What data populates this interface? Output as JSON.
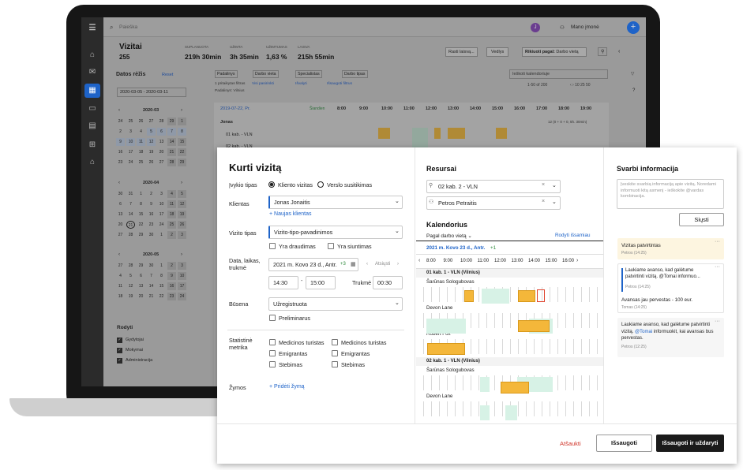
{
  "app": {
    "search_placeholder": "Paieška",
    "avatar_initial": "J",
    "company": "Mano įmonė",
    "add": "+"
  },
  "page": {
    "title": "Vizitai",
    "count": "255",
    "stats": [
      {
        "label": "SUPLANUOTA",
        "value": "219h 30min"
      },
      {
        "label": "UŽIMTA",
        "value": "3h 35min"
      },
      {
        "label": "UŽIMTUMAS",
        "value": "1,63 %"
      },
      {
        "label": "LAISVA",
        "value": "215h 55min"
      }
    ],
    "actions": {
      "find": "Rasti laisvą...",
      "guides": "Vedlys",
      "sort_label": "Rikiuoti pagal:",
      "sort_value": "Darbo vietą"
    }
  },
  "left": {
    "date_title": "Datos rėžis",
    "reset": "Reset",
    "date_range": "2020-03-05 - 2020-03-11",
    "months": [
      "2020-03",
      "2020-04",
      "2020-05"
    ],
    "march": [
      [
        "24",
        "25",
        "26",
        "27",
        "28",
        "29",
        "1"
      ],
      [
        "2",
        "3",
        "4",
        "5",
        "6",
        "7",
        "8"
      ],
      [
        "9",
        "10",
        "11",
        "12",
        "13",
        "14",
        "15"
      ],
      [
        "16",
        "17",
        "18",
        "19",
        "20",
        "21",
        "22"
      ],
      [
        "23",
        "24",
        "25",
        "26",
        "27",
        "28",
        "29"
      ]
    ],
    "april": [
      [
        "30",
        "31",
        "1",
        "2",
        "3",
        "4",
        "5"
      ],
      [
        "6",
        "7",
        "8",
        "9",
        "10",
        "11",
        "12"
      ],
      [
        "13",
        "14",
        "15",
        "16",
        "17",
        "18",
        "19"
      ],
      [
        "20",
        "21",
        "22",
        "23",
        "24",
        "25",
        "26"
      ],
      [
        "27",
        "28",
        "29",
        "30",
        "1",
        "2",
        "3"
      ]
    ],
    "may": [
      [
        "27",
        "28",
        "29",
        "30",
        "1",
        "2",
        "3"
      ],
      [
        "4",
        "5",
        "6",
        "7",
        "8",
        "9",
        "10"
      ],
      [
        "11",
        "12",
        "13",
        "14",
        "15",
        "16",
        "17"
      ],
      [
        "18",
        "19",
        "20",
        "21",
        "22",
        "23",
        "24"
      ]
    ],
    "show_title": "Rodyti",
    "show_items": [
      "Gydytojai",
      "Mokymai",
      "Administracija"
    ]
  },
  "filters": {
    "chips": [
      "Padalinys",
      "Darbo vieta",
      "Specialistas",
      "Darbo tipas"
    ],
    "applied": "1 pritaikytas filtras",
    "view_saved": "Visi pasirinkti",
    "clear_filters": "Išvalyti",
    "save_filters": "Išsaugoti filtrus",
    "tag": "Padalinys: Vilnius",
    "calendar_search": "Ieškoti kalendoriuje",
    "paging": "1-50 of 200",
    "page_nums": [
      "10",
      "25",
      "50"
    ]
  },
  "bg_cal": {
    "date": "2019-07-22, Pr.",
    "today": "Šiandien",
    "hours": [
      "8:00",
      "9:00",
      "10:00",
      "11:00",
      "12:00",
      "13:00",
      "14:00",
      "15:00",
      "16:00",
      "17:00",
      "18:00",
      "19:00"
    ],
    "person": "Jonas",
    "summary": "12 (0 + 0 + 0, 5h. 30min)",
    "row": "01 kab. - VLN",
    "row2": "02 kab. - VLN"
  },
  "modal": {
    "title": "Kurti vizitą",
    "event_type_label": "Įvykio tipas",
    "event_types": [
      "Kliento vizitas",
      "Verslo susitikimas"
    ],
    "client_label": "Klientas",
    "client_value": "Jonas Jonaitis",
    "new_client": "+ Naujas klientas",
    "visit_type_label": "Vizito tipas",
    "visit_type_value": "Vizito-tipo-pavadinimos",
    "insured": "Yra draudimas",
    "sending": "Yra siuntimas",
    "datetime_label": "Data, laikas, trukmė",
    "date_value": "2021 m. Kovo 23 d., Antr.",
    "date_extra": "+3",
    "repeat": "Atsiųsti",
    "time_from": "14:30",
    "time_to": "15:00",
    "duration_label": "Trukmė",
    "duration_value": "00:30",
    "status_label": "Būsena",
    "status_value": "Užregistruota",
    "preliminary": "Preliminarus",
    "stats_label": "Statistinė metrika",
    "stats_items": [
      "Medicinos turistas",
      "Emigrantas",
      "Stebimas"
    ],
    "tags_label": "Žymos",
    "add_tag": "+ Pridėti žymą",
    "resources_title": "Resursai",
    "resource1": "02 kab. 2 - VLN",
    "resource2": "Petros Petraitis",
    "calendar_title": "Kalendorius",
    "calendar_sort": "Pagal darbo vietą",
    "show_all": "Rodyti išsamiau",
    "cal_date": "2021 m. Kovo 23 d., Antr.",
    "cal_date_extra": "+1",
    "cal_hours": [
      "8:00",
      "9:00",
      "10:00",
      "11:00",
      "12:00",
      "13:00",
      "14:00",
      "15:00",
      "16:00"
    ],
    "cal_rows": [
      {
        "group": "01 kab. 1 - VLN (Vilnius)"
      },
      {
        "name": "Šarūnas Sologubovas"
      },
      {
        "name": "Devon Lane"
      },
      {
        "name": "Robert Fox"
      },
      {
        "group": "02 kab. 1 - VLN (Vilnius)"
      },
      {
        "name": "Šarūnas Sologubovas"
      },
      {
        "name": "Devon Lane"
      }
    ],
    "info_title": "Svarbi informacija",
    "info_placeholder": "Įveskite svarbią informaciją apie vizitą. Noredami informuoti kitą asmenį - ieškokite @vardas kombinacija.",
    "send": "Siųsti",
    "notes": [
      {
        "text": "Vizitas patvirtintas",
        "meta": "Petros (14:25)"
      },
      {
        "quote": "Laukiame avanso, kad galėtume patvirtinti vizitą. @Tomai informuo...",
        "quote_meta": "Petros (14:25)",
        "text": "Avansas jau pervestas - 100 eur.",
        "meta": "Tomas (14:25)"
      },
      {
        "text": "Laukiame avanso, kad galėtume patvirtinti vizitą.",
        "mention": "@Tomai",
        "text2": "informuokit, kai avansas bus pervestas.",
        "meta": "Petros (12:25)"
      }
    ],
    "cancel": "Atšaukti",
    "save": "Išsaugoti",
    "save_close": "Išsaugoti ir uždaryti"
  }
}
